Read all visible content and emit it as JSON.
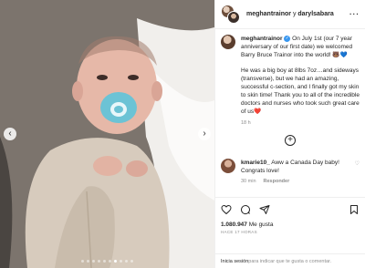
{
  "header": {
    "user1": "meghantrainor",
    "connector": " y ",
    "user2": "darylsabara",
    "more_icon": "ellipsis-icon"
  },
  "caption": {
    "username": "meghantrainor",
    "verified_symbol": "✓",
    "text1": "On July 1st (our 7 year anniversary of our first date) we welcomed Barry Bruce Trainor into the world! 🐻💙",
    "text2": "He was a big boy at 8lbs 7oz…and sideways (transverse), but we had an amazing, successful c-section, and I finally got my skin to skin time! Thank you to all of the incredible doctors and nurses who took such great care of us❤️",
    "time": "18 h"
  },
  "load_more_icon": "plus-circle-icon",
  "comments": [
    {
      "username": "kmarie10_",
      "text": "Aww a Canada Day baby! Congrats love!",
      "time": "30 min",
      "reply_label": "Responder"
    }
  ],
  "actions": {
    "icons": [
      "heart-icon",
      "comment-icon",
      "share-icon",
      "bookmark-icon"
    ],
    "likes_count": "1.080.947",
    "likes_label": "Me gusta",
    "time_ago": "HACE 17 HORAS"
  },
  "login_prompt": {
    "link": "Inicia sesión",
    "rest": " para indicar que te gusta o comentar."
  },
  "carousel": {
    "total_slides": 10,
    "active_slide": 6
  },
  "colors": {
    "pacifier": "#6cc3d5",
    "verified": "#3897f0",
    "muted_text": "#8e8e8e"
  }
}
